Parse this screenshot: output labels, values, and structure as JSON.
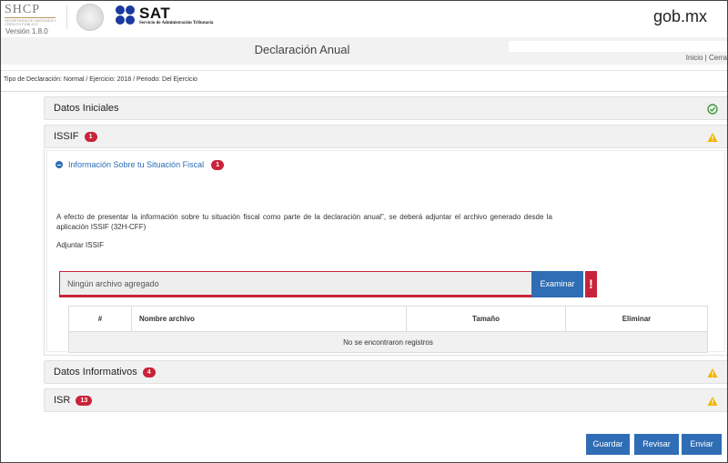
{
  "header": {
    "shcp_title": "SHCP",
    "shcp_subtitle": "SECRETARÍA DE HACIENDA Y CRÉDITO PÚBLICO",
    "version": "Versión 1.8.0",
    "sat_name": "SAT",
    "sat_subtitle": "Servicio de Administración Tributaria",
    "gob": "gob.mx"
  },
  "titlebar": {
    "title": "Declaración Anual",
    "link_inicio": "Inicio",
    "separator": " | ",
    "link_cerrar": "Cerra"
  },
  "subline": "Tipo de Declaración: Normal / Ejercicio: 2018 / Periodo: Del Ejercicio",
  "panels": {
    "datos_iniciales": {
      "title": "Datos Iniciales",
      "status_icon": "check-circle-icon"
    },
    "issif": {
      "title": "ISSIF",
      "badge": "1",
      "status_icon": "warning-icon"
    },
    "datos_informativos": {
      "title": "Datos Informativos",
      "badge": "4",
      "status_icon": "warning-icon"
    },
    "isr": {
      "title": "ISR",
      "badge": "13",
      "status_icon": "warning-icon"
    }
  },
  "issif_section": {
    "subheading": "Información Sobre tu Situación Fiscal",
    "badge": "1",
    "paragraph": "A efecto de presentar la información sobre tu situación fiscal como parte de la declaración anual\", se deberá adjuntar el archivo generado desde la aplicación ISSIF (32H-CFF)",
    "adjuntar_label": "Adjuntar ISSIF",
    "file_placeholder": "Ningún archivo agregado",
    "examinar_label": "Examinar",
    "alert_symbol": "!",
    "table": {
      "headers": [
        "#",
        "Nombre archivo",
        "Tamaño",
        "Eliminar"
      ],
      "empty_message": "No se encontraron registros"
    }
  },
  "buttons": {
    "guardar": "Guardar",
    "revisar": "Revisar",
    "enviar": "Enviar"
  },
  "colors": {
    "accent_blue": "#2f6db4",
    "badge_red": "#c9233a",
    "warning_yellow": "#f0b400",
    "success_green": "#3c9a3c"
  }
}
